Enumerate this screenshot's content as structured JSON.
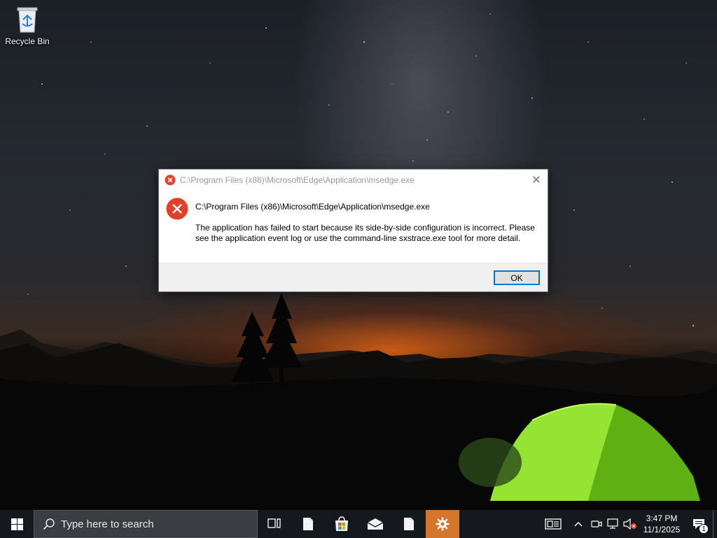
{
  "desktop": {
    "icons": [
      {
        "label": "Recycle Bin",
        "icon": "recycle-bin-icon"
      }
    ]
  },
  "dialog": {
    "title": "C:\\Program Files (x86)\\Microsoft\\Edge\\Application\\msedge.exe",
    "path": "C:\\Program Files (x86)\\Microsoft\\Edge\\Application\\msedge.exe",
    "message": "The application has failed to start because its side-by-side configuration is incorrect. Please see the application event log or use the command-line sxstrace.exe tool for more detail.",
    "ok_label": "OK",
    "close_glyph": "✕",
    "icon": "error-icon",
    "accent": "#e0412b"
  },
  "taskbar": {
    "search_placeholder": "Type here to search",
    "apps": [
      "task-view-icon",
      "file-icon",
      "microsoft-store-icon",
      "mail-icon",
      "file-icon",
      "settings-icon"
    ],
    "active_app": "settings-icon",
    "active_color": "#d4752d",
    "clock": {
      "time": "3:47 PM",
      "date": "11/1/2025"
    },
    "notification_count": "1"
  }
}
